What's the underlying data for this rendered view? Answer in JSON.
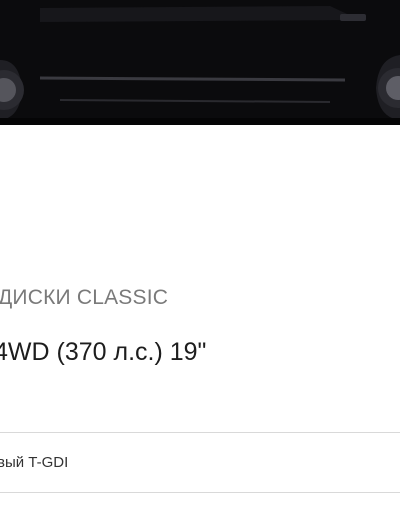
{
  "variant": {
    "wheels_label": "ДИСКИ CLASSIC",
    "trim_line": "4WD (370 л.с.) 19\"",
    "engine_label": "вый T-GDI"
  },
  "colors": {
    "car_body": "#0b0b0d",
    "title_text": "#1d1d1d",
    "subtitle_text": "#7a7a7a",
    "divider": "#d9d9d9"
  }
}
